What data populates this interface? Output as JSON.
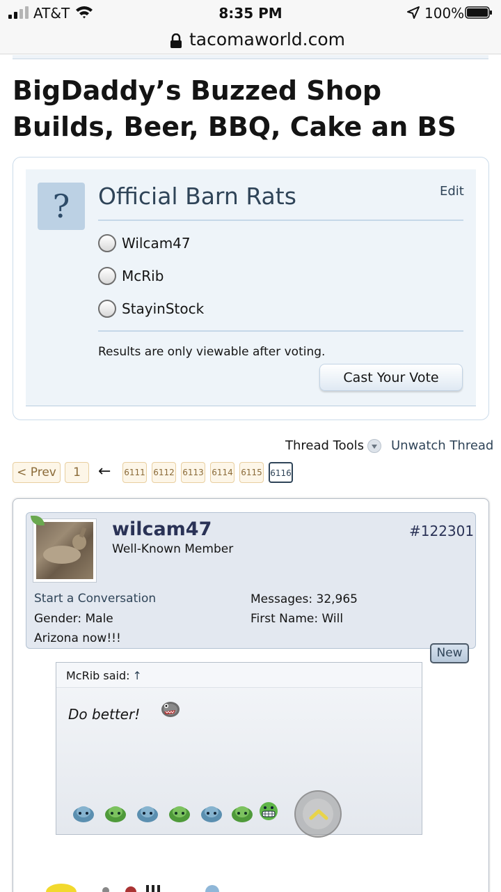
{
  "status_bar": {
    "carrier": "AT&T",
    "time": "8:35 PM",
    "battery": "100%"
  },
  "browser": {
    "url": "tacomaworld.com"
  },
  "thread": {
    "title": "BigDaddy’s Buzzed Shop Builds, Beer, BBQ, Cake an BS"
  },
  "poll": {
    "question_icon": "?",
    "title": "Official Barn Rats",
    "edit_label": "Edit",
    "options": [
      "Wilcam47",
      "McRib",
      "StayinStock"
    ],
    "note": "Results are only viewable after voting.",
    "vote_button": "Cast Your Vote"
  },
  "tools": {
    "thread_tools": "Thread Tools",
    "unwatch": "Unwatch Thread"
  },
  "pagination": {
    "prev": "< Prev",
    "first": "1",
    "arrow": "←",
    "pages": [
      "6111",
      "6112",
      "6113",
      "6114",
      "6115",
      "6116"
    ],
    "current": "6116"
  },
  "post": {
    "username": "wilcam47",
    "user_title": "Well-Known Member",
    "post_number": "#122301",
    "start_conversation": "Start a Conversation",
    "gender_label": "Gender:",
    "gender_value": "Male",
    "location": "Arizona now!!!",
    "messages_label": "Messages:",
    "messages_value": "32,965",
    "first_name_label": "First Name:",
    "first_name_value": "Will",
    "new_badge": "New",
    "quote": {
      "author": "McRib said:",
      "arrow": "↑",
      "text": "Do better!"
    }
  },
  "colors": {
    "accent_blue": "#2f4458",
    "page_tab_border": "#e8cfa0",
    "poll_bg": "#eef4f9",
    "post_head_bg": "#e3e8f0"
  },
  "icons": {
    "signal": "signal-bars-icon",
    "wifi": "wifi-icon",
    "location": "location-arrow-icon",
    "battery": "battery-icon",
    "lock": "lock-icon",
    "dropdown": "chevron-down-icon",
    "scroll_top": "scroll-to-top-icon"
  }
}
